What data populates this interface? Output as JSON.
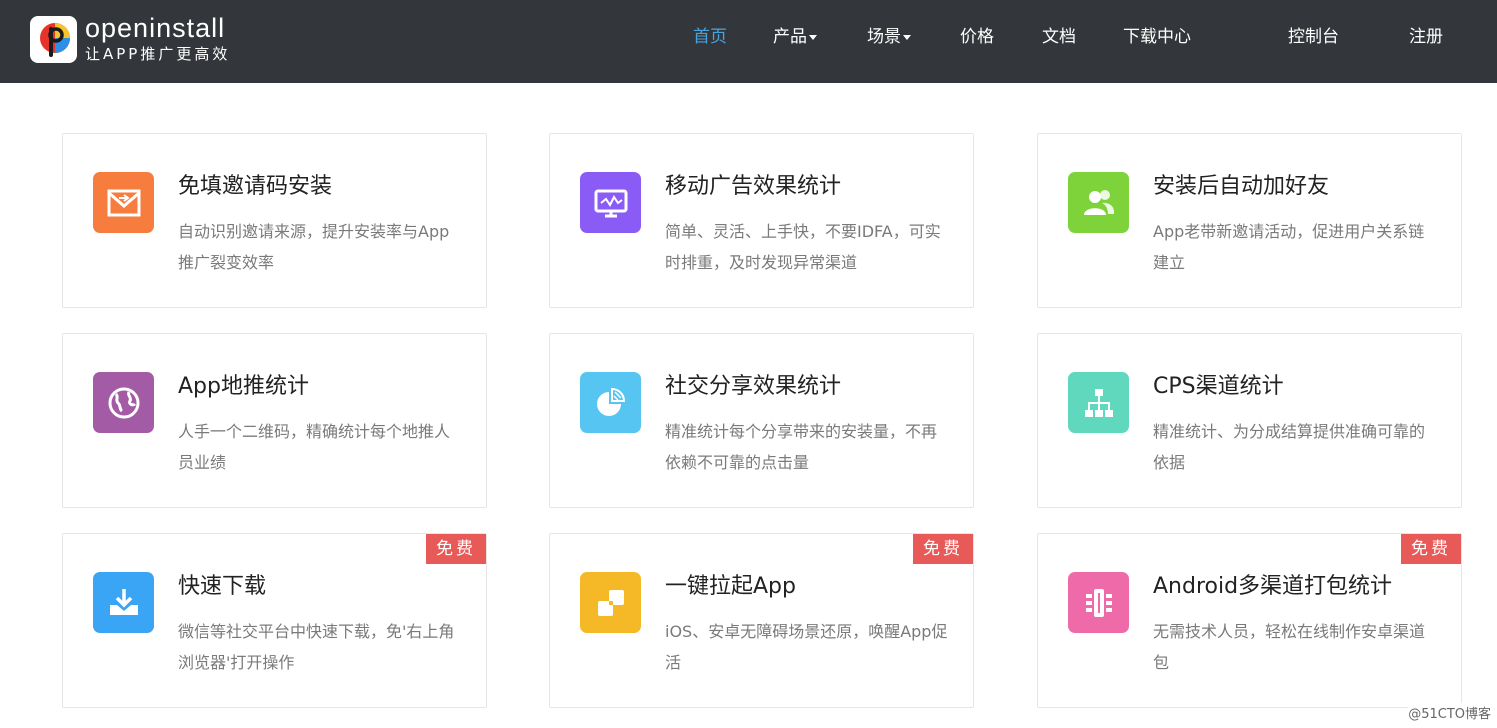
{
  "header": {
    "logo": {
      "name": "openinstall",
      "slogan": "让APP推广更高效"
    },
    "nav": [
      {
        "label": "首页",
        "active": true
      },
      {
        "label": "产品",
        "dropdown": true
      },
      {
        "label": "场景",
        "dropdown": true
      },
      {
        "label": "价格"
      },
      {
        "label": "文档"
      },
      {
        "label": "下载中心"
      }
    ],
    "console": "控制台",
    "register": "注册"
  },
  "colors": {
    "navbar_bg": "#33363a",
    "nav_active": "#4aa3df",
    "badge_bg": "#e85a57"
  },
  "features": [
    {
      "title": "免填邀请码安装",
      "desc": "自动识别邀请来源，提升安装率与App推广裂变效率",
      "icon": "envelope-icon",
      "color": "#f77d3e"
    },
    {
      "title": "移动广告效果统计",
      "desc": "简单、灵活、上手快，不要IDFA，可实时排重，及时发现异常渠道",
      "icon": "monitor-chart-icon",
      "color": "#8a5cf5"
    },
    {
      "title": "安装后自动加好友",
      "desc": "App老带新邀请活动，促进用户关系链建立",
      "icon": "users-icon",
      "color": "#7ed33b"
    },
    {
      "title": "App地推统计",
      "desc": "人手一个二维码，精确统计每个地推人员业绩",
      "icon": "globe-icon",
      "color": "#a45ba6"
    },
    {
      "title": "社交分享效果统计",
      "desc": "精准统计每个分享带来的安装量，不再依赖不可靠的点击量",
      "icon": "pie-chart-icon",
      "color": "#57c5f2"
    },
    {
      "title": "CPS渠道统计",
      "desc": "精准统计、为分成结算提供准确可靠的依据",
      "icon": "org-chart-icon",
      "color": "#5fd8be"
    },
    {
      "title": "快速下载",
      "desc": "微信等社交平台中快速下载，免'右上角浏览器'打开操作",
      "icon": "download-icon",
      "color": "#3aa4f5",
      "badge": "免费"
    },
    {
      "title": "一键拉起App",
      "desc": "iOS、安卓无障碍场景还原，唤醒App促活",
      "icon": "squares-icon",
      "color": "#f5b927",
      "badge": "免费"
    },
    {
      "title": "Android多渠道打包统计",
      "desc": "无需技术人员，轻松在线制作安卓渠道包",
      "icon": "package-icon",
      "color": "#ef6aa8",
      "badge": "免费"
    }
  ],
  "watermark": "@51CTO博客"
}
